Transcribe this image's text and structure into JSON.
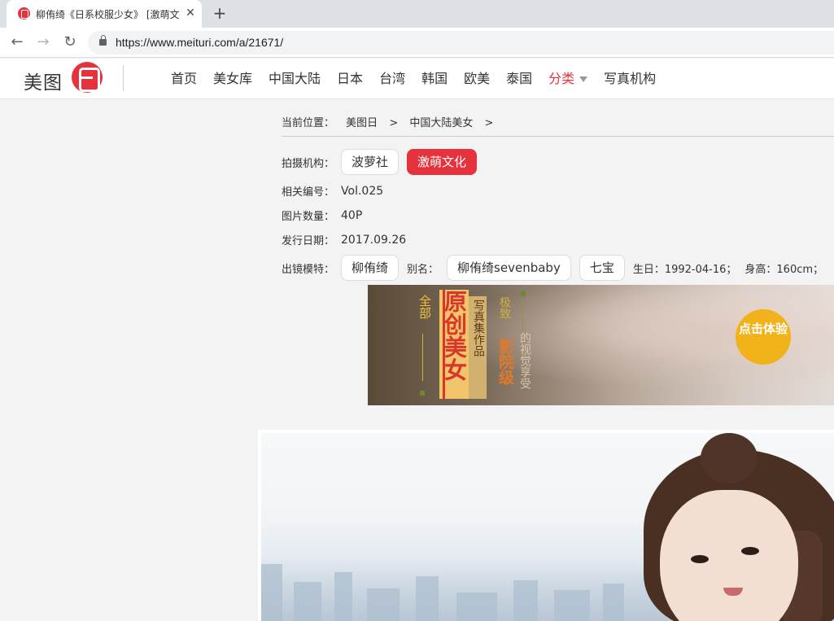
{
  "browser": {
    "tab_title": "柳侑绮《日系校服少女》 [激萌文",
    "tab_close": "✕",
    "new_tab": "+",
    "back": "←",
    "forward": "→",
    "reload": "↻",
    "url": "https://www.meituri.com/a/21671/"
  },
  "site": {
    "logo_text": "美图",
    "nav": [
      {
        "label": "首页"
      },
      {
        "label": "美女库"
      },
      {
        "label": "中国大陆"
      },
      {
        "label": "日本"
      },
      {
        "label": "台湾"
      },
      {
        "label": "韩国"
      },
      {
        "label": "欧美"
      },
      {
        "label": "泰国"
      },
      {
        "label": "分类",
        "active": true,
        "dropdown": true
      },
      {
        "label": "写真机构"
      }
    ],
    "accent_color": "#e6323c"
  },
  "breadcrumb": {
    "label": "当前位置：",
    "items": [
      "美图日",
      "中国大陆美女"
    ],
    "separator": ">"
  },
  "info": {
    "org_label": "拍摄机构：",
    "org_tags": [
      "波萝社",
      "激萌文化"
    ],
    "number_label": "相关编号：",
    "number_value": "Vol.025",
    "count_label": "图片数量：",
    "count_value": "40P",
    "date_label": "发行日期：",
    "date_value": "2017.09.26",
    "model_label": "出镜模特：",
    "model_name": "柳侑绮",
    "alias_label": "别名：",
    "aliases": [
      "柳侑绮sevenbaby",
      "七宝"
    ],
    "birthday": "生日：1992-04-16；",
    "height": "身高：160cm；"
  },
  "banner": {
    "all": "全部",
    "original": "原创美女",
    "subtitle": "写真集作品",
    "extreme": "极致",
    "cinema": "影院级",
    "visual": "的视觉享受",
    "cta": "点击体验"
  }
}
